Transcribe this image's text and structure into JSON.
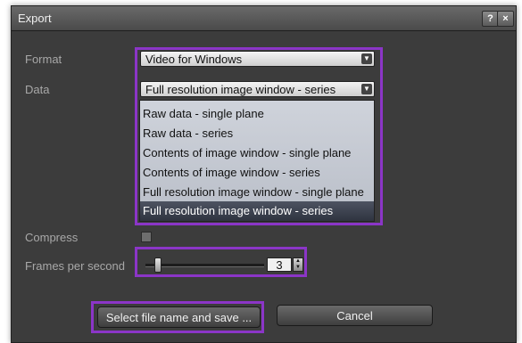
{
  "window": {
    "title": "Export",
    "help_label": "?",
    "close_label": "×"
  },
  "format": {
    "label": "Format",
    "value": "Video for Windows"
  },
  "data_field": {
    "label": "Data",
    "value": "Full resolution image window - series"
  },
  "data_options": [
    "Raw data - single plane",
    "Raw data - series",
    "Contents of image window - single plane",
    "Contents of image window - series",
    "Full resolution image window - single plane",
    "Full resolution image window - series"
  ],
  "selected_option_index": 5,
  "compress": {
    "label": "Compress",
    "checked": false
  },
  "frames": {
    "label": "Frames per second",
    "value": "3",
    "up": "▲",
    "down": "▼"
  },
  "buttons": {
    "save": "Select file name and save ...",
    "cancel": "Cancel"
  },
  "dropdown_arrow": "▼",
  "colors": {
    "highlight": "#8b35c7",
    "dialog_bg": "#3c3c3c",
    "selected_item": "#3a3f4b"
  }
}
